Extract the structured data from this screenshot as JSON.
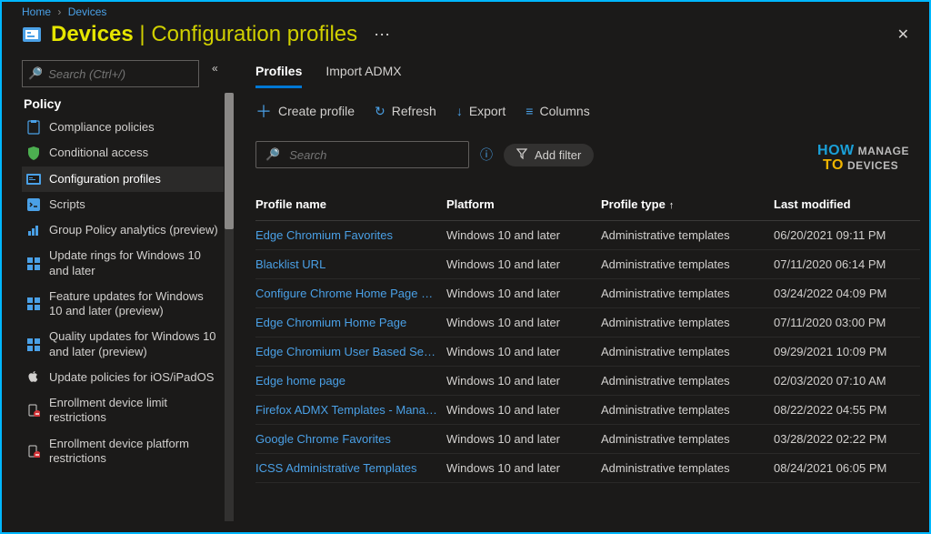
{
  "breadcrumb": {
    "home": "Home",
    "devices": "Devices"
  },
  "header": {
    "title_main": "Devices",
    "title_sep": " | ",
    "title_sub": "Configuration profiles"
  },
  "sidebar": {
    "search_placeholder": "Search (Ctrl+/)",
    "section": "Policy",
    "items": [
      {
        "label": "Compliance policies"
      },
      {
        "label": "Conditional access"
      },
      {
        "label": "Configuration profiles"
      },
      {
        "label": "Scripts"
      },
      {
        "label": "Group Policy analytics (preview)"
      },
      {
        "label": "Update rings for Windows 10 and later"
      },
      {
        "label": "Feature updates for Windows 10 and later (preview)"
      },
      {
        "label": "Quality updates for Windows 10 and later (preview)"
      },
      {
        "label": "Update policies for iOS/iPadOS"
      },
      {
        "label": "Enrollment device limit restrictions"
      },
      {
        "label": "Enrollment device platform restrictions"
      }
    ]
  },
  "tabs": {
    "profiles": "Profiles",
    "import": "Import ADMX"
  },
  "toolbar": {
    "create": "Create profile",
    "refresh": "Refresh",
    "export": "Export",
    "columns": "Columns"
  },
  "filters": {
    "search_placeholder": "Search",
    "add_filter": "Add filter"
  },
  "columns": {
    "name": "Profile name",
    "platform": "Platform",
    "type": "Profile type",
    "modified": "Last modified"
  },
  "rows": [
    {
      "name": "Edge Chromium Favorites",
      "platform": "Windows 10 and later",
      "type": "Administrative templates",
      "modified": "06/20/2021 09:11 PM"
    },
    {
      "name": "Blacklist URL",
      "platform": "Windows 10 and later",
      "type": "Administrative templates",
      "modified": "07/11/2020 06:14 PM"
    },
    {
      "name": "Configure Chrome Home Page URL",
      "platform": "Windows 10 and later",
      "type": "Administrative templates",
      "modified": "03/24/2022 04:09 PM"
    },
    {
      "name": "Edge Chromium Home Page",
      "platform": "Windows 10 and later",
      "type": "Administrative templates",
      "modified": "07/11/2020 03:00 PM"
    },
    {
      "name": "Edge Chromium User Based Security",
      "platform": "Windows 10 and later",
      "type": "Administrative templates",
      "modified": "09/29/2021 10:09 PM"
    },
    {
      "name": "Edge home page",
      "platform": "Windows 10 and later",
      "type": "Administrative templates",
      "modified": "02/03/2020 07:10 AM"
    },
    {
      "name": "Firefox ADMX Templates - Manage H",
      "platform": "Windows 10 and later",
      "type": "Administrative templates",
      "modified": "08/22/2022 04:55 PM"
    },
    {
      "name": "Google Chrome Favorites",
      "platform": "Windows 10 and later",
      "type": "Administrative templates",
      "modified": "03/28/2022 02:22 PM"
    },
    {
      "name": "ICSS Administrative Templates",
      "platform": "Windows 10 and later",
      "type": "Administrative templates",
      "modified": "08/24/2021 06:05 PM"
    }
  ],
  "watermark": {
    "how": "HOW",
    "to": "TO",
    "manage": "MANAGE",
    "devices": "DEVICES"
  }
}
